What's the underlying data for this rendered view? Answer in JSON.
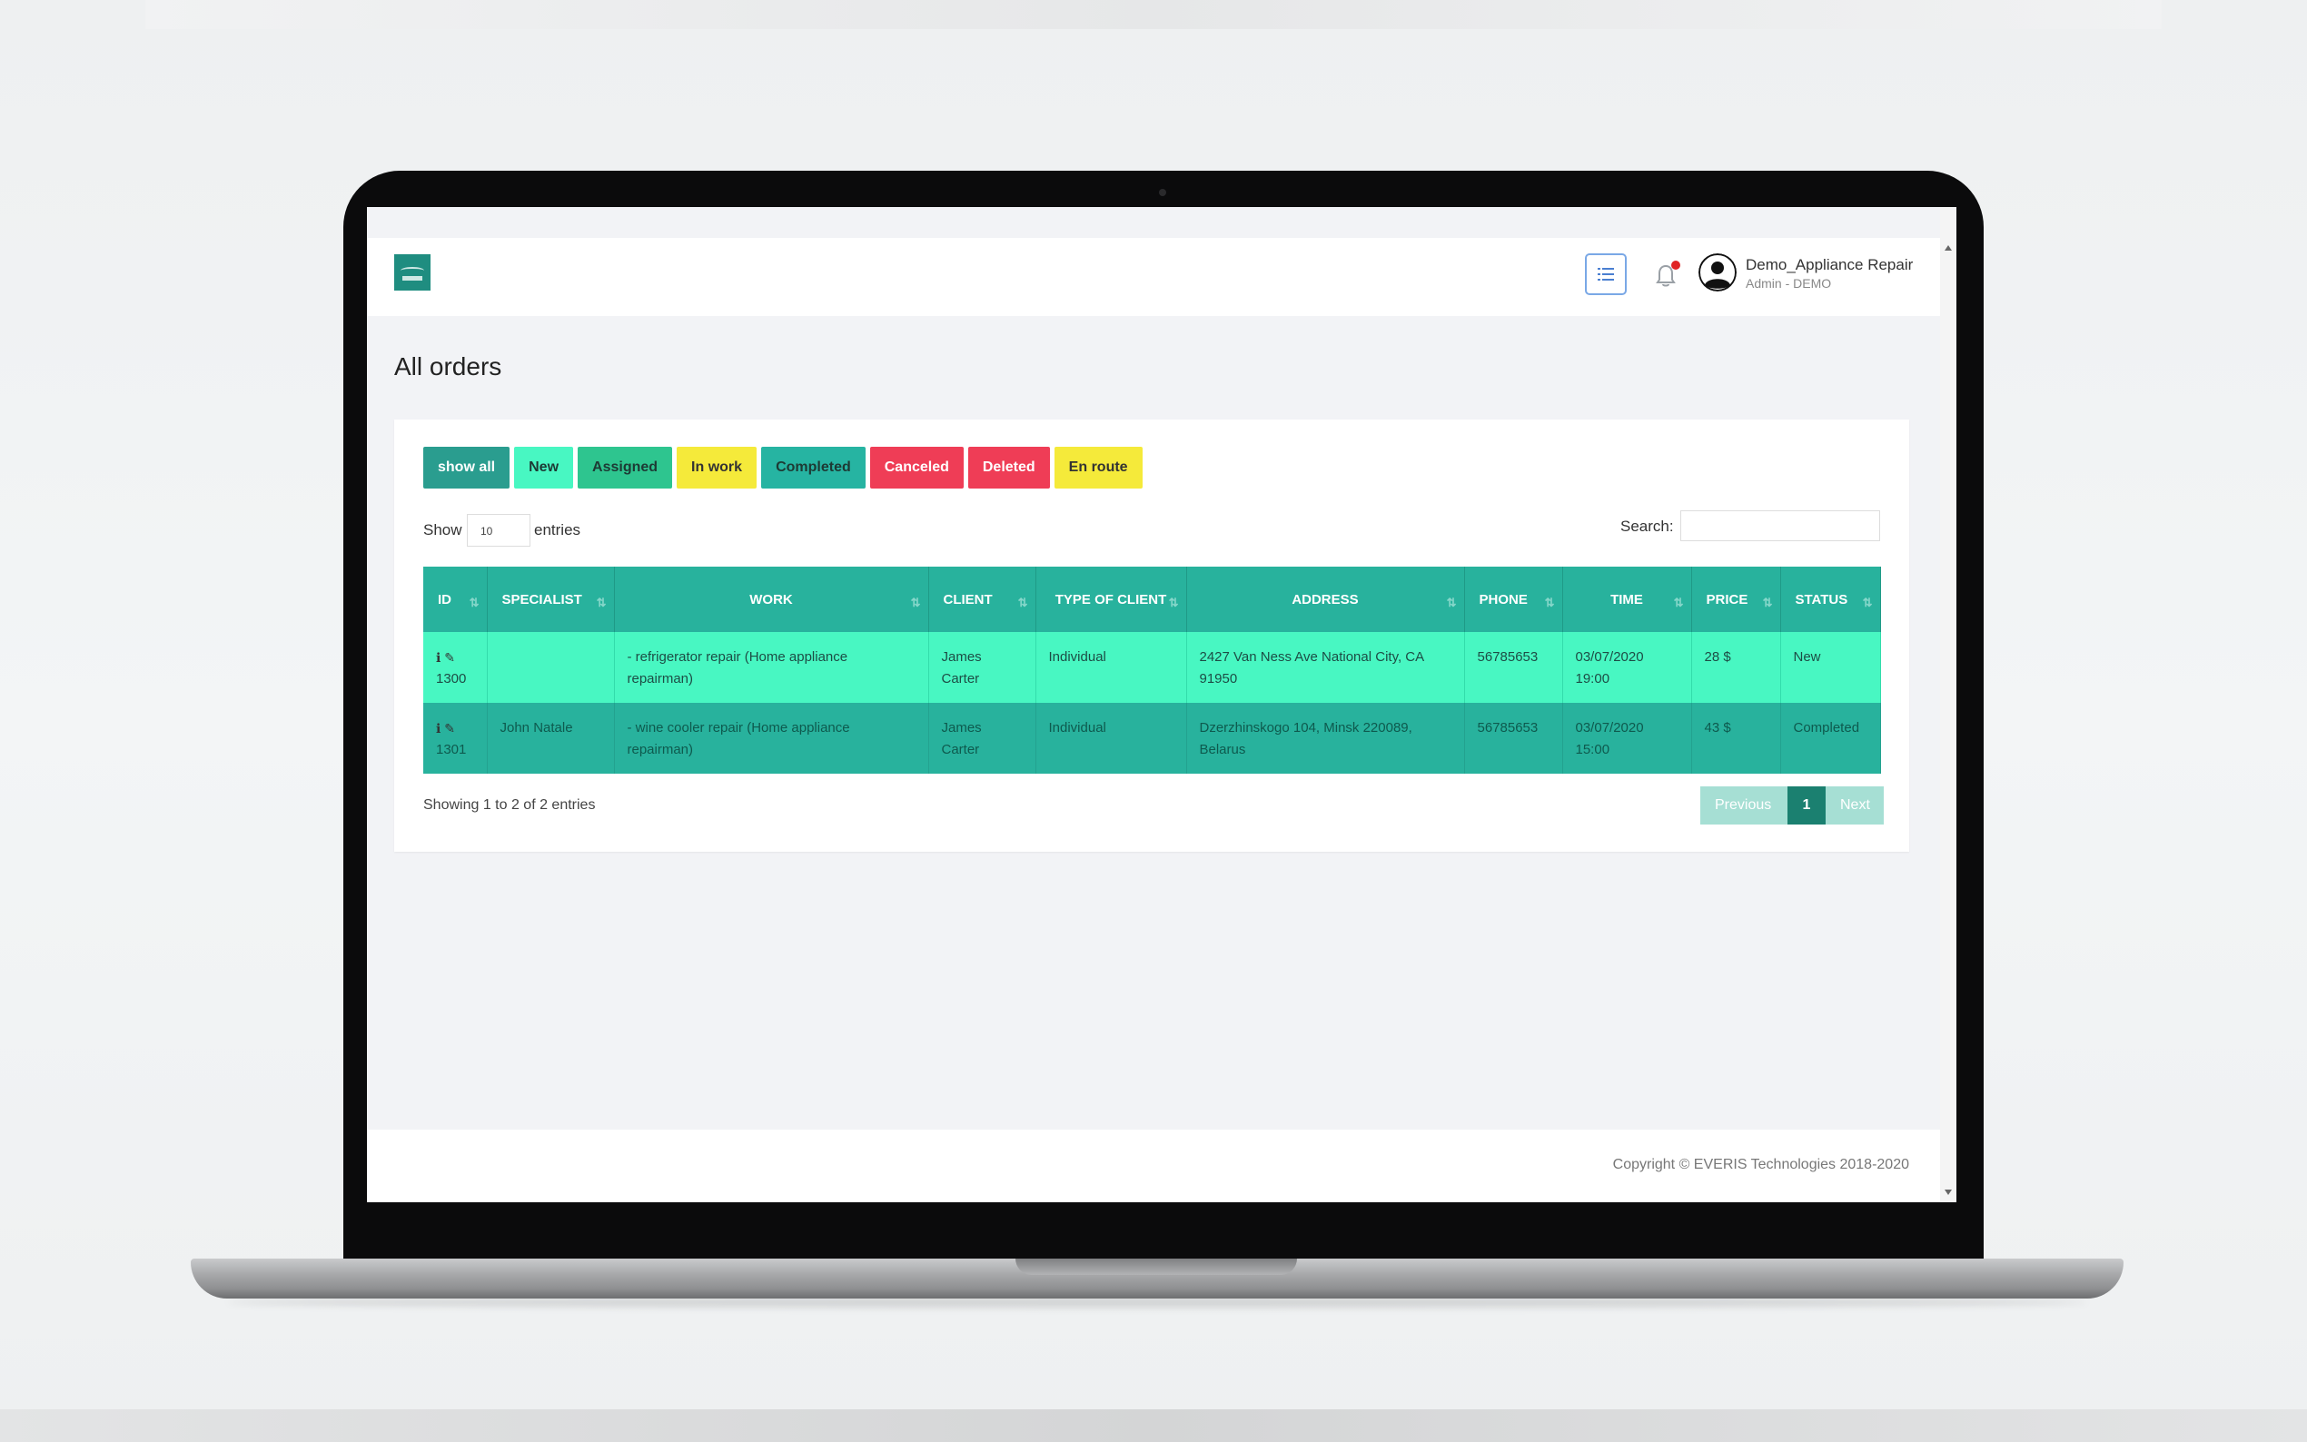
{
  "header": {
    "user_name": "Demo_Appliance Repair",
    "user_role": "Admin - DEMO"
  },
  "page": {
    "title": "All orders"
  },
  "filters": [
    {
      "label": "show all",
      "bg": "#2a9d8f",
      "color": "#ffffff"
    },
    {
      "label": "New",
      "bg": "#48f7c2",
      "color": "#1d3a34"
    },
    {
      "label": "Assigned",
      "bg": "#2ec58f",
      "color": "#1d3a34"
    },
    {
      "label": "In work",
      "bg": "#f5ea3a",
      "color": "#333333"
    },
    {
      "label": "Completed",
      "bg": "#26b4a2",
      "color": "#1d3a34"
    },
    {
      "label": "Canceled",
      "bg": "#ef3d56",
      "color": "#ffffff"
    },
    {
      "label": "Deleted",
      "bg": "#ef3d56",
      "color": "#ffffff"
    },
    {
      "label": "En route",
      "bg": "#f5ea3a",
      "color": "#333333"
    }
  ],
  "controls": {
    "show_label": "Show",
    "entries_value": "10",
    "entries_label": "entries",
    "search_label": "Search:",
    "search_value": ""
  },
  "table": {
    "columns": [
      "ID",
      "SPECIALIST",
      "WORK",
      "CLIENT",
      "TYPE OF CLIENT",
      "ADDRESS",
      "PHONE",
      "TIME",
      "PRICE",
      "STATUS"
    ],
    "rows": [
      {
        "id": "1300",
        "specialist": "",
        "work": "- refrigerator repair (Home appliance repairman)",
        "client": "James Carter",
        "client_type": "Individual",
        "address": "2427 Van Ness Ave National City, CA 91950",
        "phone": "56785653",
        "time": "03/07/2020 19:00",
        "price": "28 $",
        "status": "New"
      },
      {
        "id": "1301",
        "specialist": "John Natale",
        "work": "- wine cooler repair (Home appliance repairman)",
        "client": "James Carter",
        "client_type": "Individual",
        "address": "Dzerzhinskogo 104, Minsk 220089, Belarus",
        "phone": "56785653",
        "time": "03/07/2020 15:00",
        "price": "43 $",
        "status": "Completed"
      }
    ]
  },
  "table_info": "Showing 1 to 2 of 2 entries",
  "pagination": {
    "previous": "Previous",
    "current": "1",
    "next": "Next"
  },
  "footer": {
    "copyright": "Copyright © EVERIS Technologies 2018-2020"
  },
  "colors": {
    "accent": "#28b29d",
    "row_new": "#48f7c2",
    "row_completed": "#28b29d",
    "pager_active": "#1b8070"
  }
}
